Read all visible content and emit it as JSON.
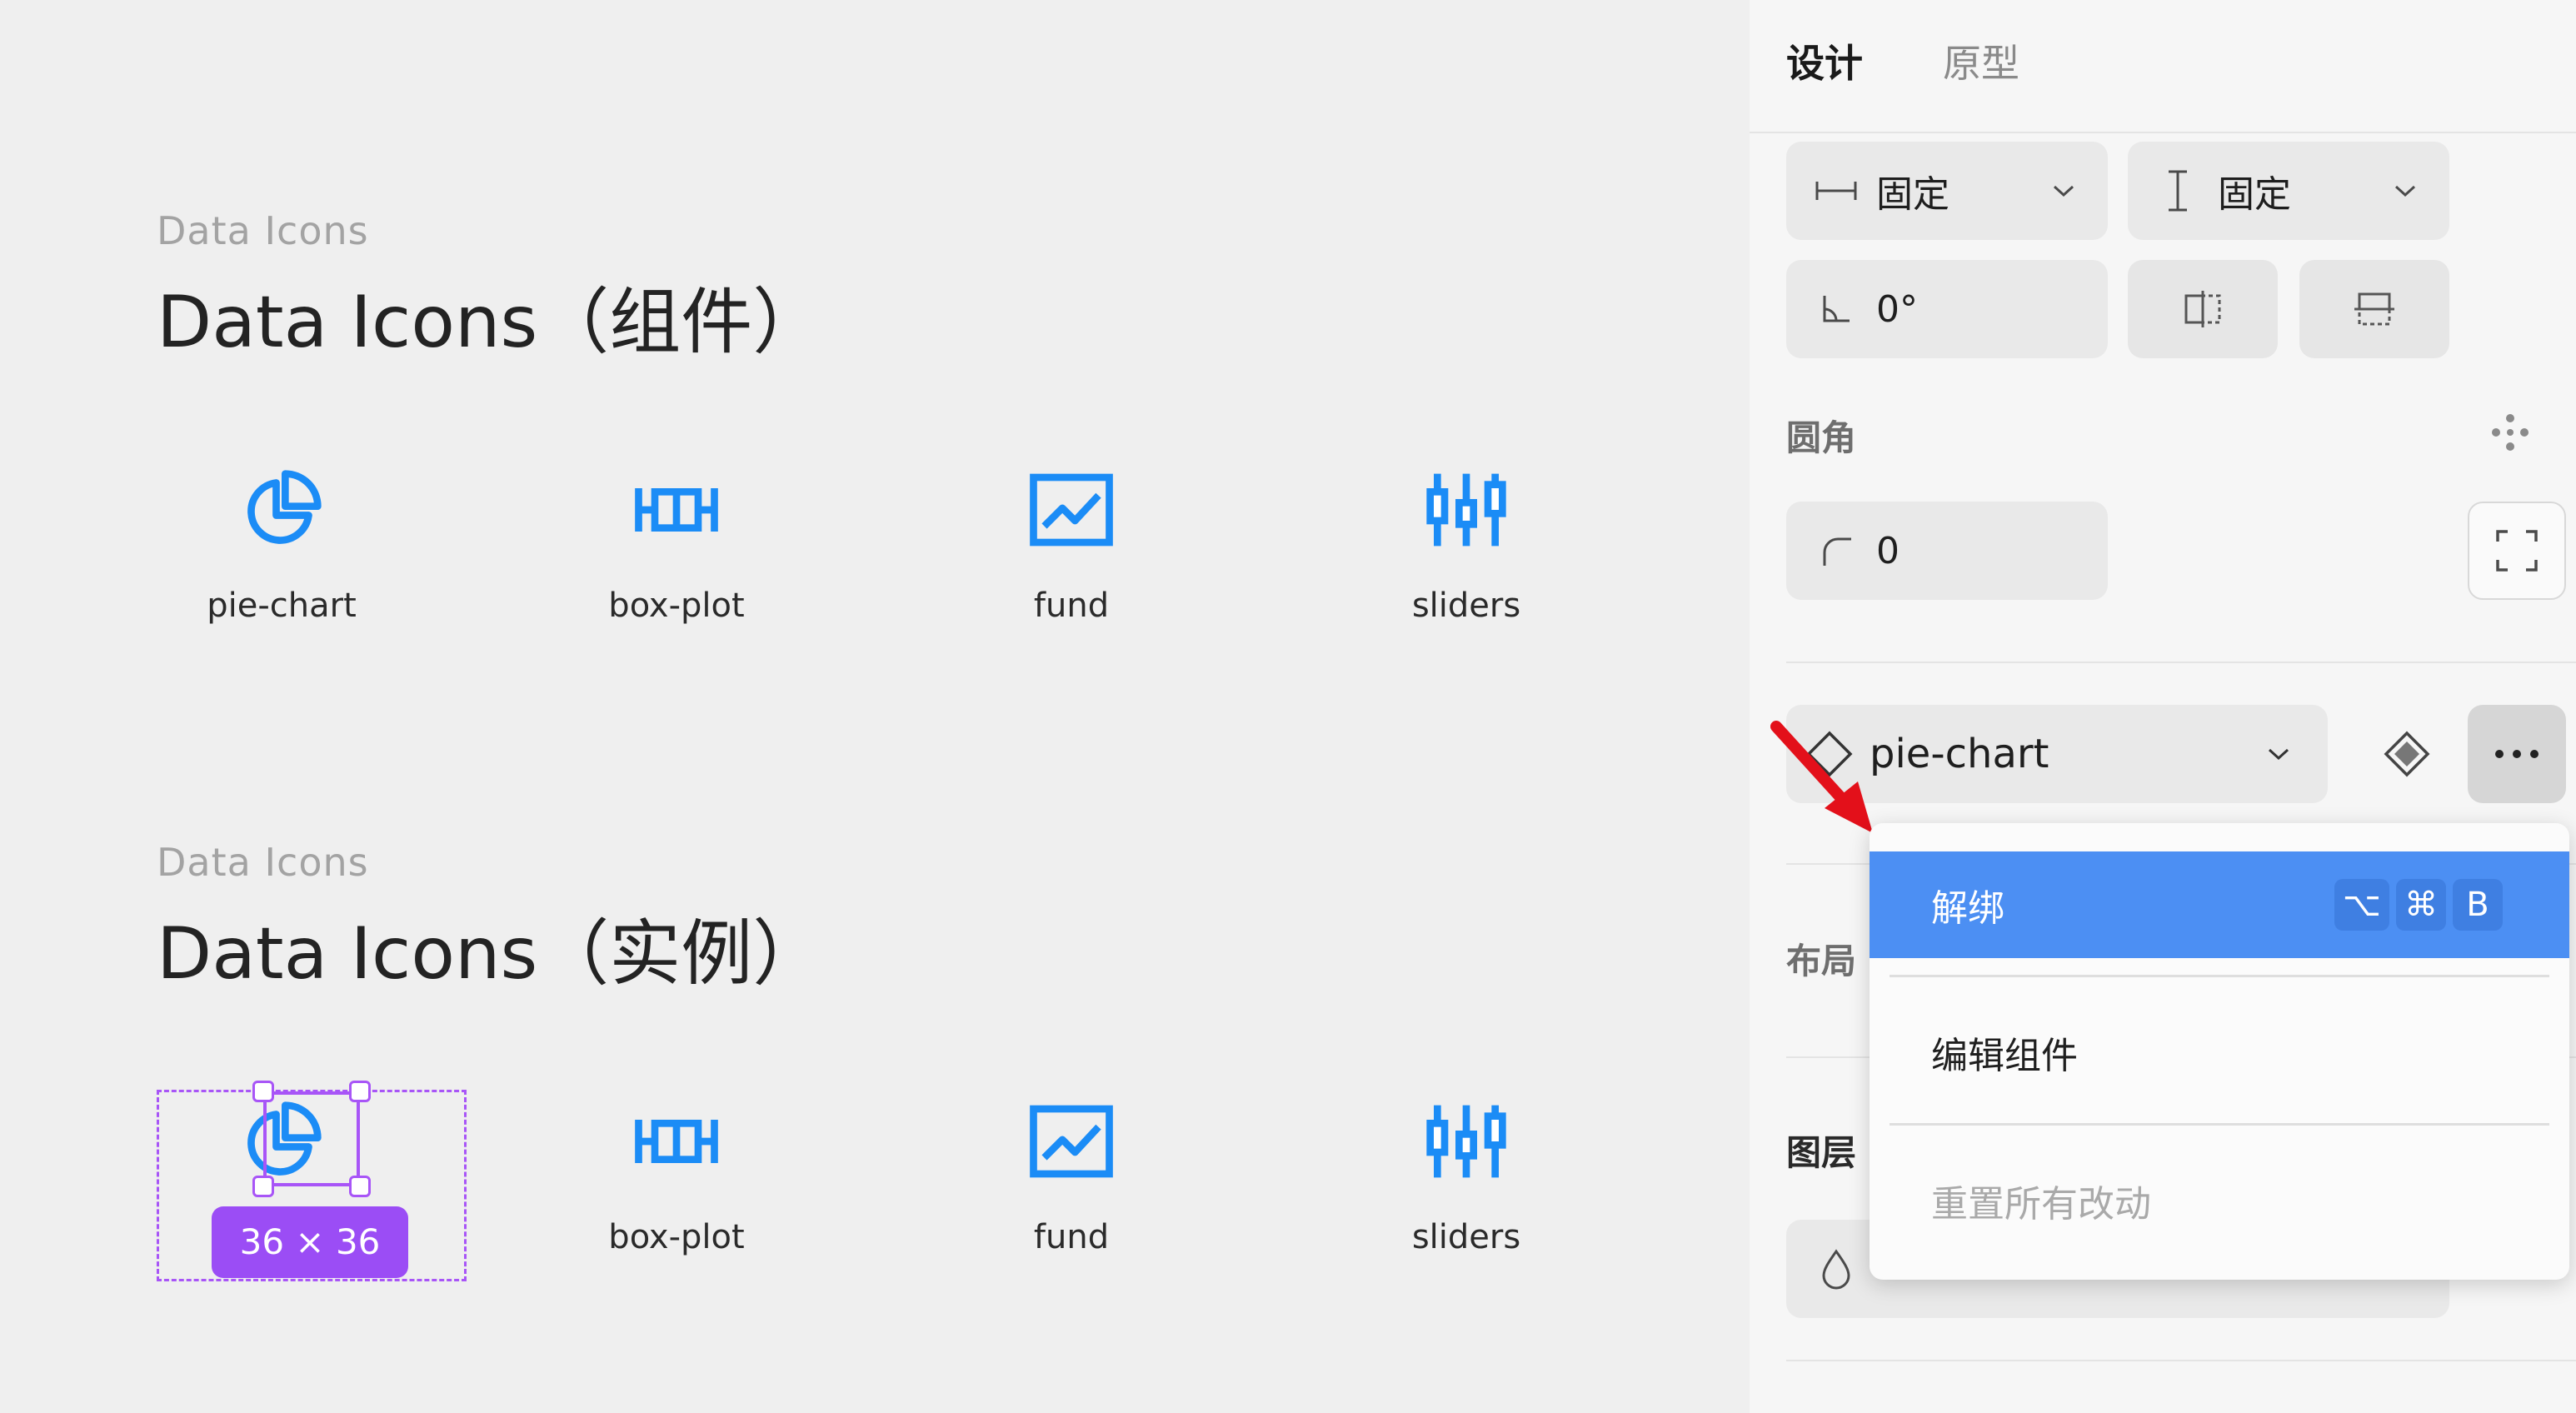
{
  "canvas": {
    "groups": [
      {
        "label": "Data Icons",
        "title": "Data Icons（组件）",
        "icons": [
          {
            "label": "pie-chart",
            "icon": "pie-chart-icon"
          },
          {
            "label": "box-plot",
            "icon": "box-plot-icon"
          },
          {
            "label": "fund",
            "icon": "fund-icon"
          },
          {
            "label": "sliders",
            "icon": "sliders-icon"
          }
        ]
      },
      {
        "label": "Data Icons",
        "title": "Data Icons（实例）",
        "icons": [
          {
            "label": "",
            "icon": "pie-chart-icon"
          },
          {
            "label": "box-plot",
            "icon": "box-plot-icon"
          },
          {
            "label": "fund",
            "icon": "fund-icon"
          },
          {
            "label": "sliders",
            "icon": "sliders-icon"
          }
        ]
      }
    ],
    "selection_badge": "36 × 36"
  },
  "panel": {
    "tabs": [
      {
        "label": "设计",
        "active": true
      },
      {
        "label": "原型",
        "active": false
      }
    ],
    "width_mode": "固定",
    "height_mode": "固定",
    "rotation": "0°",
    "corner_section": "圆角",
    "corner_radius": "0",
    "component_name": "pie-chart",
    "layout_section": "布局",
    "layer_section": "图层"
  },
  "context_menu": {
    "items": [
      {
        "label": "解绑",
        "shortcut": [
          "⌥",
          "⌘",
          "B"
        ],
        "active": true
      },
      {
        "label": "编辑组件",
        "active": false
      },
      {
        "label": "重置所有改动",
        "disabled": true
      }
    ]
  },
  "colors": {
    "icon_blue": "#1b8cf6",
    "selection_purple": "#a855f7",
    "menu_active": "#4c8ff3",
    "annotation_arrow": "#e3101a"
  }
}
